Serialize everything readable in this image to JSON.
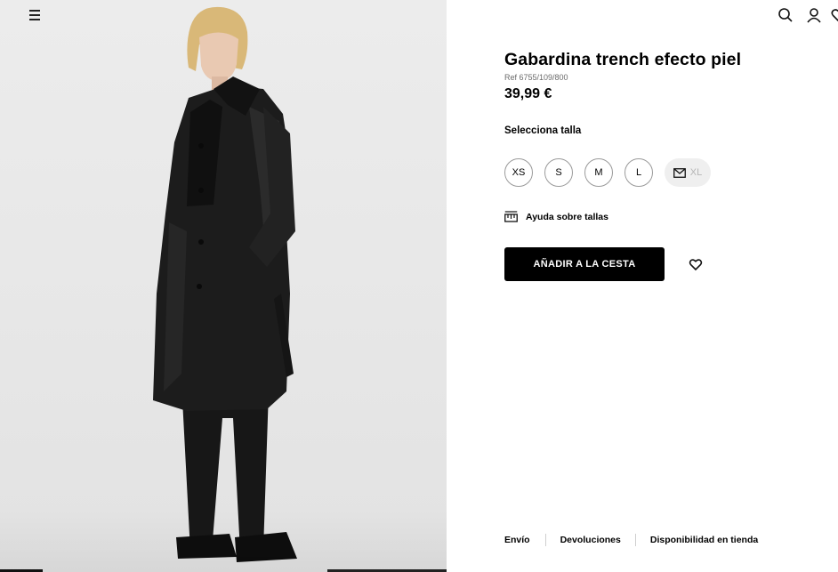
{
  "header": {
    "menu_icon": "hamburger-menu-icon",
    "icons": [
      "search-icon",
      "user-icon",
      "heart-icon"
    ]
  },
  "product": {
    "title": "Gabardina trench efecto piel",
    "ref": "Ref 6755/109/800",
    "price": "39,99 €",
    "image_description_icon": "product-photo"
  },
  "size_selector": {
    "label": "Selecciona talla",
    "sizes": [
      {
        "label": "XS",
        "available": true
      },
      {
        "label": "S",
        "available": true
      },
      {
        "label": "M",
        "available": true
      },
      {
        "label": "L",
        "available": true
      },
      {
        "label": "XL",
        "available": false,
        "icon": "mail-icon"
      }
    ]
  },
  "size_help": {
    "label": "Ayuda sobre tallas",
    "icon": "ruler-icon"
  },
  "actions": {
    "add_to_cart": "AÑADIR A LA CESTA",
    "wishlist_icon": "heart-icon"
  },
  "footer_links": [
    "Envío",
    "Devoluciones",
    "Disponibilidad en tienda"
  ],
  "colors": {
    "primary": "#000000",
    "background_image": "#e8e8e8",
    "muted_text": "#6b6b6b",
    "disabled_size_bg": "#efefef"
  }
}
